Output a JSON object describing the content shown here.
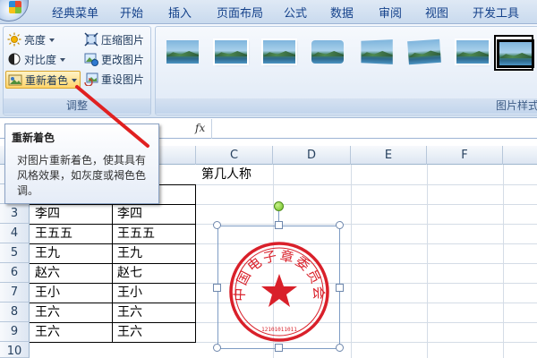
{
  "tabs": [
    "经典菜单",
    "开始",
    "插入",
    "页面布局",
    "公式",
    "数据",
    "审阅",
    "视图",
    "开发工具"
  ],
  "ribbon": {
    "adjust_group": {
      "label": "调整",
      "brightness": "亮度",
      "contrast": "对比度",
      "recolor": "重新着色",
      "compress": "压缩图片",
      "change_picture": "更改图片",
      "reset_picture": "重设图片"
    },
    "styles_group": {
      "label": "图片样式",
      "selected_style_index": 8
    }
  },
  "formula_bar": {
    "fx_label": "fx"
  },
  "tooltip": {
    "title": "重新着色",
    "body": "对图片重新着色，使其具有风格效果，如灰度或褐色色调。"
  },
  "grid": {
    "columns": [
      "C",
      "D",
      "E",
      "F"
    ],
    "rows": [
      "3",
      "4",
      "5",
      "6",
      "7",
      "8",
      "9",
      "10"
    ],
    "c1_text": "第几人称",
    "table": [
      [
        "李四",
        "李四"
      ],
      [
        "王五五",
        "王五五"
      ],
      [
        "王九",
        "王九"
      ],
      [
        "赵六",
        "赵七"
      ],
      [
        "王小",
        "王小"
      ],
      [
        "王六",
        "王六"
      ],
      [
        "王六",
        "王六"
      ]
    ]
  },
  "stamp": {
    "outer_text": "中国电子章委员会",
    "inner_numbers": "12101011011",
    "color": "#d9202a"
  },
  "colors": {
    "accent": "#1e395b",
    "stamp_red": "#d9202a",
    "arrow_red": "#e02020"
  },
  "icons": [
    "office-logo-icon",
    "brightness-icon",
    "contrast-icon",
    "recolor-icon",
    "compress-icon",
    "change-picture-icon",
    "reset-picture-icon",
    "fx-icon"
  ]
}
